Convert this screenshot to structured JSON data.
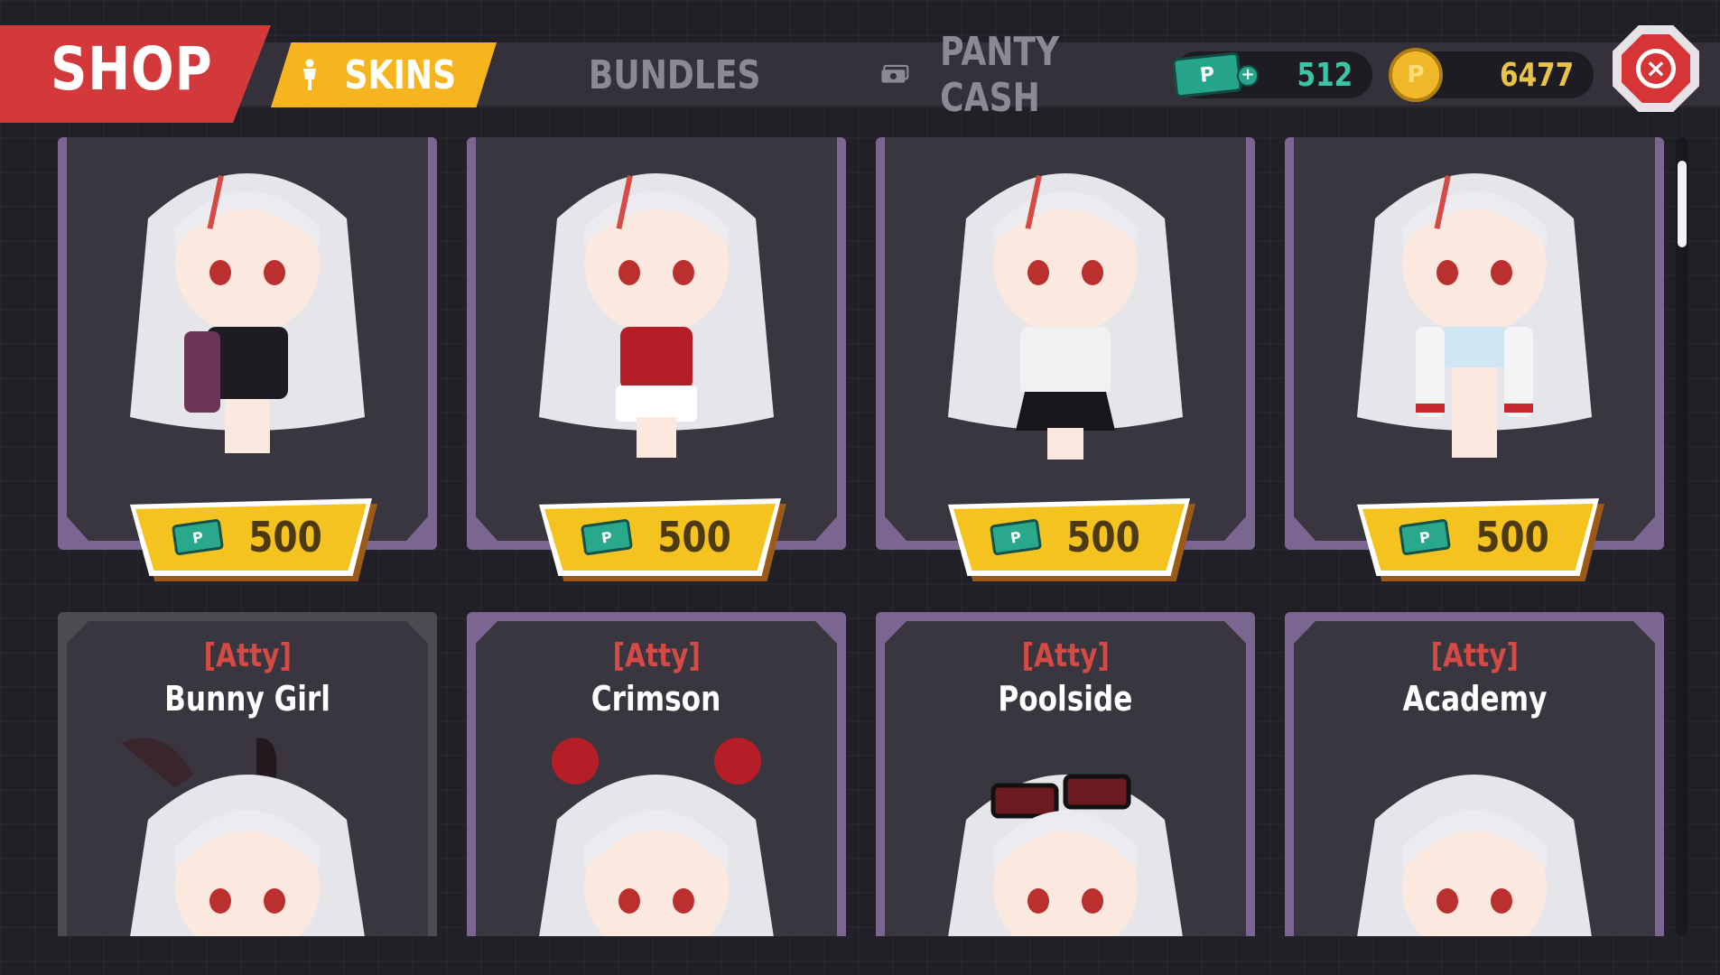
{
  "header": {
    "title": "SHOP",
    "tabs": [
      {
        "label": "SKINS",
        "icon": "person-icon",
        "active": true
      },
      {
        "label": "BUNDLES",
        "icon": "layers-icon",
        "active": false
      },
      {
        "label": "PANTY CASH",
        "icon": "cash-stack-icon",
        "active": false
      }
    ],
    "cash_amount": "512",
    "coin_amount": "6477",
    "cash_symbol": "P",
    "plus": "+",
    "close": "×"
  },
  "colors": {
    "accent": "#f5c31f",
    "shop_red": "#d3383a",
    "card_border": "#7a6690",
    "cash_green": "#27a58a"
  },
  "top_row": [
    {
      "price": "500",
      "hair": "#e6e6ea",
      "outfit": "#1e1b22",
      "accent": "#6b3557"
    },
    {
      "price": "500",
      "hair": "#e6e6ea",
      "outfit": "#b51e26",
      "accent": "#ffffff"
    },
    {
      "price": "500",
      "hair": "#e6e6ea",
      "outfit": "#f1f1f1",
      "accent": "#18161b"
    },
    {
      "price": "500",
      "hair": "#e6e6ea",
      "outfit": "#cfe6f5",
      "accent": "#c5272d"
    }
  ],
  "bottom_row": [
    {
      "tag": "[Atty]",
      "name": "Bunny Girl",
      "hair": "#e6e6ea",
      "prop": "bunny-ears"
    },
    {
      "tag": "[Atty]",
      "name": "Crimson",
      "hair": "#e6e6ea",
      "prop": "hair-buns"
    },
    {
      "tag": "[Atty]",
      "name": "Poolside",
      "hair": "#e6e6ea",
      "prop": "sunglasses"
    },
    {
      "tag": "[Atty]",
      "name": "Academy",
      "hair": "#e6e6ea",
      "prop": "none"
    }
  ]
}
